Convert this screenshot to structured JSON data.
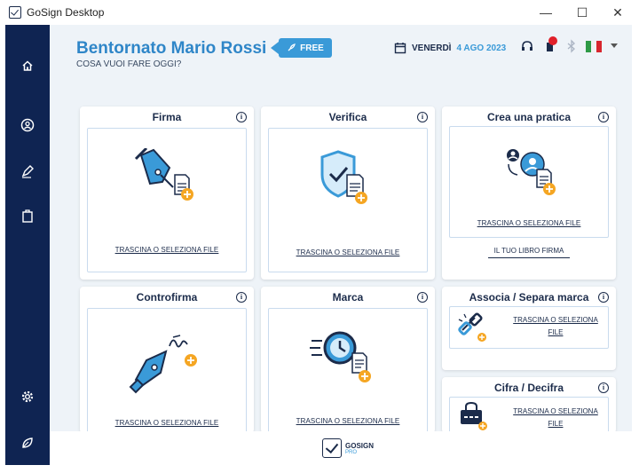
{
  "window": {
    "title": "GoSign Desktop",
    "minimize": "—",
    "maximize": "☐",
    "close": "✕"
  },
  "header": {
    "greeting": "Bentornato Mario Rossi",
    "subtitle": "COSA VUOI FARE OGGI?",
    "plan_badge": "FREE",
    "date_day": "VENERDÌ",
    "date_value": "4 AGO 2023"
  },
  "cards": {
    "firma": {
      "title": "Firma",
      "link": "TRASCINA O SELEZIONA FILE"
    },
    "verifica": {
      "title": "Verifica",
      "link": "TRASCINA O SELEZIONA FILE"
    },
    "crea_pratica": {
      "title": "Crea una pratica",
      "link": "TRASCINA O SELEZIONA FILE",
      "libro": "IL TUO LIBRO FIRMA"
    },
    "controfirma": {
      "title": "Controfirma",
      "link": "TRASCINA O SELEZIONA FILE"
    },
    "marca": {
      "title": "Marca",
      "link": "TRASCINA O SELEZIONA FILE"
    },
    "associa": {
      "title": "Associa / Separa marca",
      "link_line1": "TRASCINA O SELEZIONA",
      "link_line2": "FILE"
    },
    "cifra": {
      "title": "Cifra / Decifra",
      "link_line1": "TRASCINA O SELEZIONA",
      "link_line2": "FILE"
    }
  },
  "footer": {
    "logo_name": "GOSIGN",
    "logo_sub": "PRO"
  },
  "colors": {
    "sidebar": "#0f2452",
    "accent": "#3a9ad8",
    "badge_orange": "#f5a623",
    "bg": "#eef3f8"
  }
}
